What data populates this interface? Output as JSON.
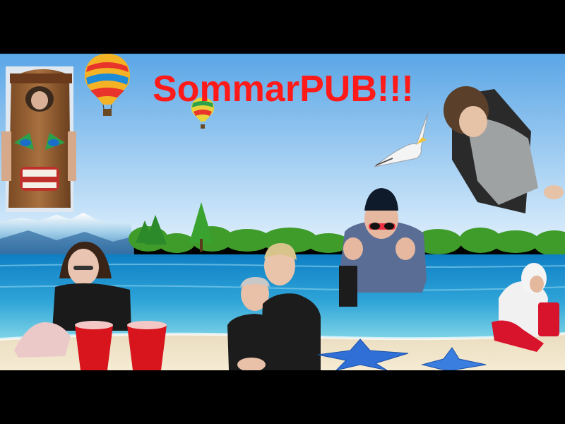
{
  "title": {
    "text": "SommarPUB!!!"
  },
  "colors": {
    "title": "#ff1a1a",
    "frame": "#000000",
    "sky_top": "#5aa6e6",
    "sky_bottom": "#d9ecfb",
    "sea_deep": "#0f7fc4",
    "sea_shallow": "#4ec3e4",
    "sand": "#f2e6c9",
    "trees": "#3f9b2a",
    "cups": "#d8141c",
    "starfish": "#2f6fd6"
  },
  "icons": {
    "balloon_large": "hot-air-balloon-icon",
    "balloon_small": "hot-air-balloon-icon",
    "gull": "seagull-icon",
    "cups": "red-cup-icon",
    "starfish": "starfish-icon"
  }
}
